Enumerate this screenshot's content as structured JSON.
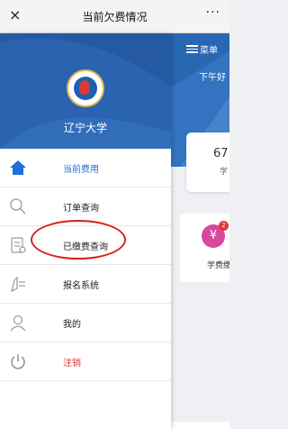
{
  "topbar": {
    "title": "当前欠费情况",
    "close_glyph": "×",
    "more_glyph": "···"
  },
  "drawer": {
    "school_name": "辽宁大学",
    "items": [
      {
        "label": "当前费用",
        "icon": "home-icon",
        "active": true
      },
      {
        "label": "订单查询",
        "icon": "search-icon"
      },
      {
        "label": "已缴费查询",
        "icon": "receipt-icon"
      },
      {
        "label": "报名系统",
        "icon": "pen-icon"
      },
      {
        "label": "我的",
        "icon": "user-icon"
      },
      {
        "label": "注销",
        "icon": "power-icon",
        "logout": true
      }
    ]
  },
  "right_page": {
    "menu_label": "菜单",
    "greeting": "下午好",
    "card_number": "67",
    "card_label": "学",
    "fee_label": "学费缴费",
    "badge": "2",
    "fee_icon_glyph": "¥"
  },
  "colors": {
    "accent": "#2a63b0",
    "active": "#1e6fd9",
    "logout": "#e03434",
    "highlight_circle": "#d81e1e"
  }
}
